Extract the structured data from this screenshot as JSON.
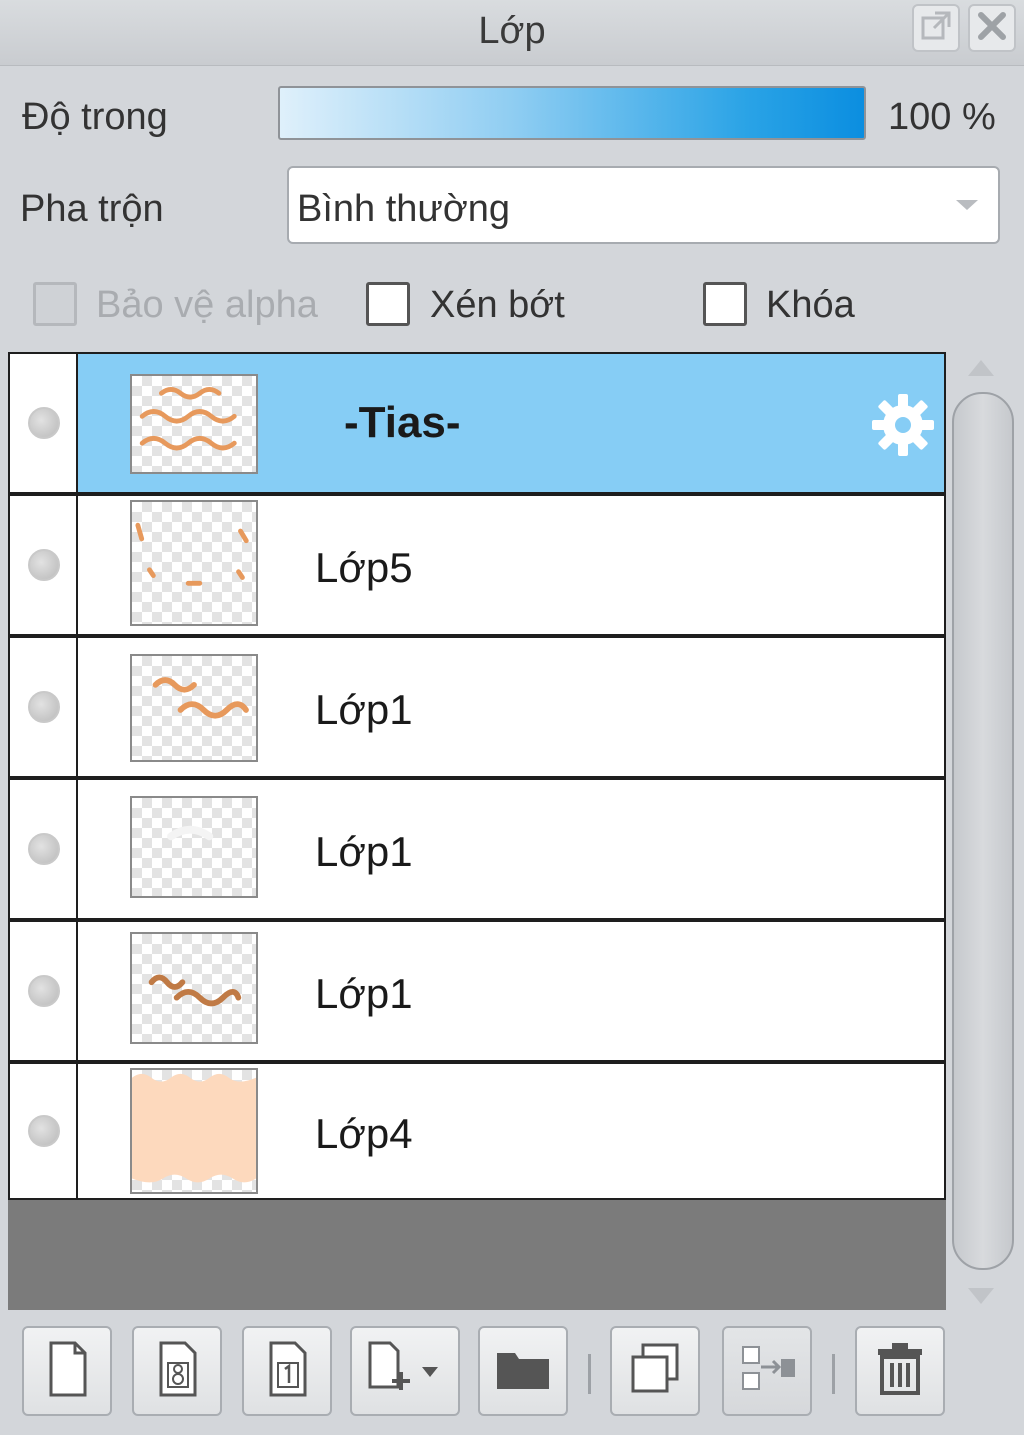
{
  "panel": {
    "title": "Lớp",
    "undock_icon": "undock-icon",
    "close_icon": "close-icon"
  },
  "opacity": {
    "label": "Độ trong",
    "value_text": "100 %",
    "level_percent": 100
  },
  "blend": {
    "label": "Pha trộn",
    "selected": "Bình thường"
  },
  "options": {
    "protect_alpha": {
      "label": "Bảo vệ alpha",
      "checked": false,
      "disabled": true
    },
    "clipping": {
      "label": "Xén bớt",
      "checked": false
    },
    "lock": {
      "label": "Khóa",
      "checked": false
    }
  },
  "layers": [
    {
      "name": "-Tias-",
      "selected": true,
      "thumb": "text-art-orange"
    },
    {
      "name": "Lớp5",
      "selected": false,
      "thumb": "sparse-orange-marks"
    },
    {
      "name": "Lớp1",
      "selected": false,
      "thumb": "handwriting-orange"
    },
    {
      "name": "Lớp1",
      "selected": false,
      "thumb": "faint-white-shape"
    },
    {
      "name": "Lớp1",
      "selected": false,
      "thumb": "handwriting-brown"
    },
    {
      "name": "Lớp4",
      "selected": false,
      "thumb": "peach-fill"
    }
  ],
  "toolbar": {
    "buttons": [
      "new-layer-icon",
      "new-8bit-layer-icon",
      "new-1bit-layer-icon",
      "add-material-dropdown-icon",
      "new-folder-icon",
      "duplicate-layer-icon",
      "merge-down-icon",
      "delete-layer-icon"
    ]
  },
  "colors": {
    "selected_row": "#86cdf5",
    "opacity_fill": "#0b8ee0",
    "list_background": "#7b7b7b"
  }
}
